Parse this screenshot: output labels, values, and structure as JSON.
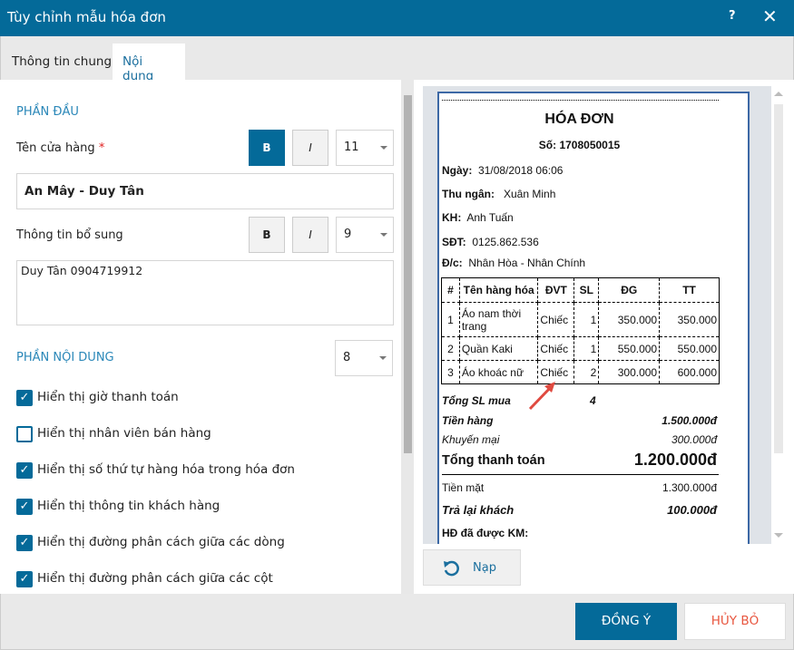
{
  "dialog": {
    "title": "Tùy chỉnh mẫu hóa đơn",
    "help": "?",
    "close": "✕"
  },
  "tabs": [
    {
      "label": "Thông tin chung"
    },
    {
      "label": "Nội dung"
    }
  ],
  "header_section": {
    "title": "PHẦN ĐẦU",
    "store_name": {
      "label": "Tên cửa hàng",
      "required": "*",
      "bold": "B",
      "italic": "I",
      "font_size": "11",
      "value": "An Mây - Duy Tân"
    },
    "extra_info": {
      "label": "Thông tin bổ sung",
      "bold": "B",
      "italic": "I",
      "font_size": "9",
      "value": "Duy Tân 0904719912"
    }
  },
  "content_section": {
    "title": "PHẦN NỘI DUNG",
    "font_size": "8",
    "options": [
      {
        "label": "Hiển thị giờ thanh toán",
        "checked": true
      },
      {
        "label": "Hiển thị nhân viên bán hàng",
        "checked": false
      },
      {
        "label": "Hiển thị số thứ tự hàng hóa trong hóa đơn",
        "checked": true
      },
      {
        "label": "Hiển thị thông tin khách hàng",
        "checked": true
      },
      {
        "label": "Hiển thị đường phân cách giữa các dòng",
        "checked": true
      },
      {
        "label": "Hiển thị đường phân cách giữa các cột",
        "checked": true
      }
    ]
  },
  "receipt": {
    "title": "HÓA ĐƠN",
    "number": "Số: 1708050015",
    "date_label": "Ngày:",
    "date": "31/08/2018 06:06",
    "cashier_label": "Thu ngân:",
    "cashier": "Xuân Minh",
    "customer_label": "KH:",
    "customer": "Anh Tuấn",
    "phone_label": "SĐT:",
    "phone": "0125.862.536",
    "address_label": "Đ/c:",
    "address": "Nhân Hòa - Nhân Chính",
    "columns": [
      "#",
      "Tên hàng hóa",
      "ĐVT",
      "SL",
      "ĐG",
      "TT"
    ],
    "items": [
      [
        "1",
        "Áo nam thời trang",
        "Chiếc",
        "1",
        "350.000",
        "350.000"
      ],
      [
        "2",
        "Quần Kaki",
        "Chiếc",
        "1",
        "550.000",
        "550.000"
      ],
      [
        "3",
        "Áo khoác nữ",
        "Chiếc",
        "2",
        "300.000",
        "600.000"
      ]
    ],
    "total_qty_label": "Tổng SL mua",
    "total_qty": "4",
    "subtotal_label": "Tiền hàng",
    "subtotal": "1.500.000đ",
    "discount_label": "Khuyến mại",
    "discount": "300.000đ",
    "grand_total_label": "Tổng thanh toán",
    "grand_total": "1.200.000đ",
    "cash_label": "Tiền mặt",
    "cash": "1.300.000đ",
    "change_label": "Trả lại khách",
    "change": "100.000đ",
    "promo_label": "HĐ đã được KM:"
  },
  "reload_button": "Nạp",
  "footer": {
    "ok": "ĐỒNG Ý",
    "cancel": "HỦY BỎ"
  },
  "colors": {
    "primary": "#046a99",
    "cancel_text": "#e8563f",
    "arrow": "#e04a40"
  }
}
